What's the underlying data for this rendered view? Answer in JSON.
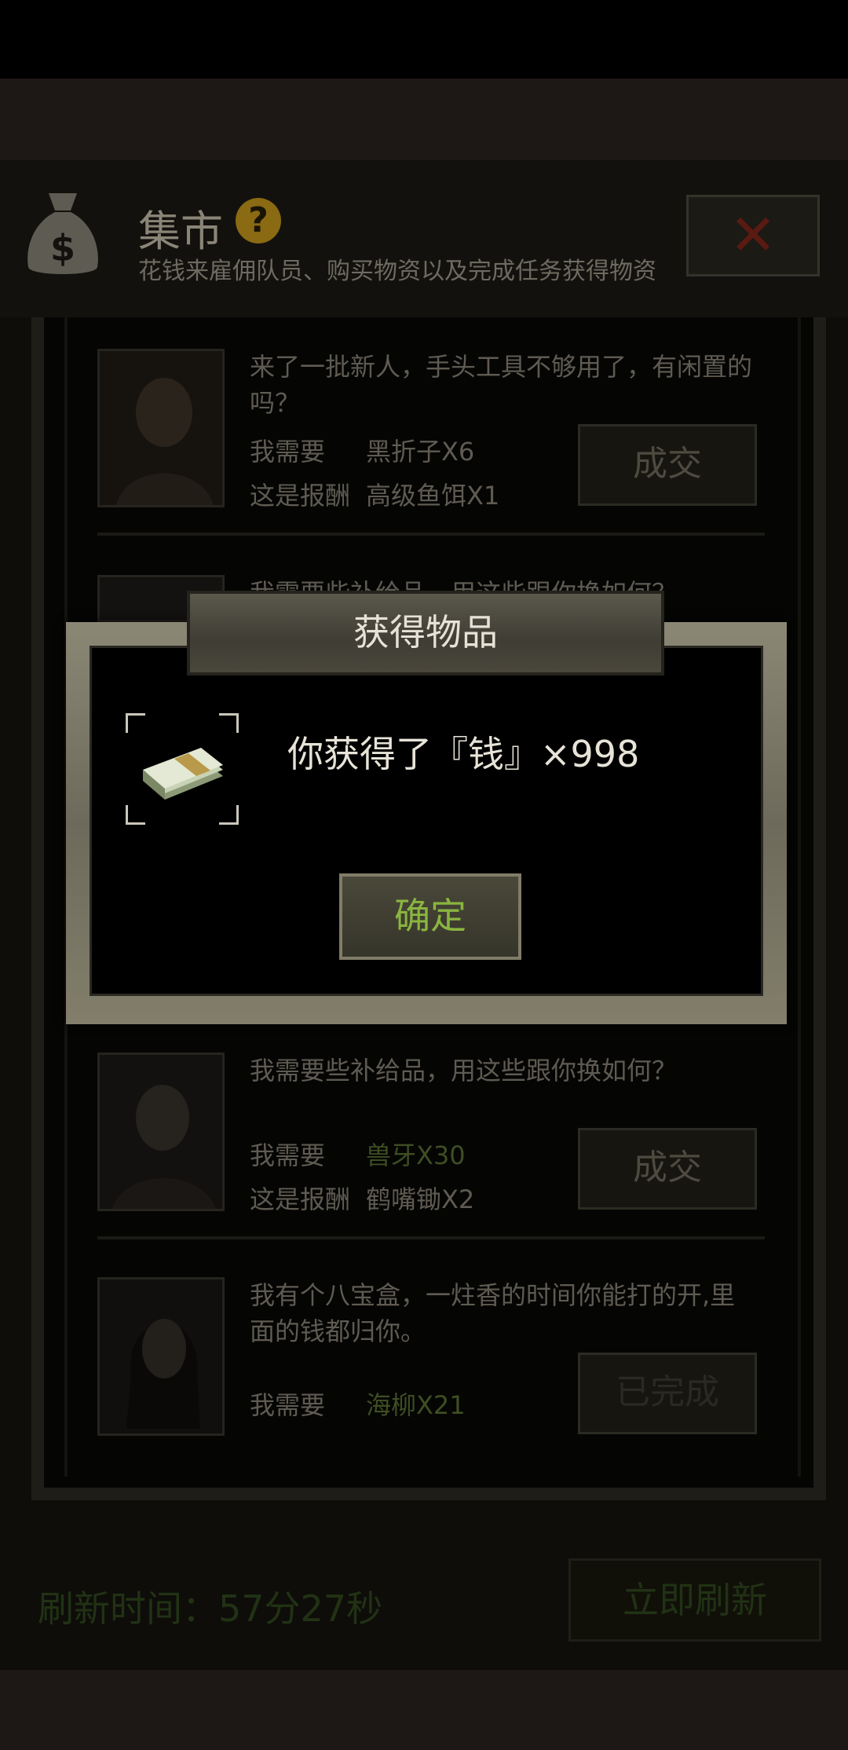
{
  "market": {
    "title": "集市",
    "help_icon": "?",
    "subtitle": "花钱来雇佣队员、购买物资以及完成任务获得物资",
    "close_icon": "✕"
  },
  "labels": {
    "need": "我需要",
    "reward": "这是报酬"
  },
  "quests": [
    {
      "text": "来了一批新人，手头工具不够用了，有闲置的吗？",
      "need_value": "黑折子X6",
      "reward_value": "高级鱼饵X1",
      "button": "成交"
    },
    {
      "text": "我需要些补给品，用这些跟你换如何？",
      "need_value": "",
      "reward_value": "",
      "button": ""
    },
    {
      "text": "我需要些补给品，用这些跟你换如何？",
      "need_value": "兽牙X30",
      "reward_value": "鹤嘴锄X2",
      "button": "成交"
    },
    {
      "text": "我有个八宝盒，一炷香的时间你能打的开,里面的钱都归你。",
      "need_value": "海柳X21",
      "button": "已完成"
    }
  ],
  "refresh": {
    "label": "刷新时间：57分27秒",
    "button": "立即刷新"
  },
  "dialog": {
    "title": "获得物品",
    "message": "你获得了『钱』×998",
    "item_icon": "money-stack-icon",
    "confirm": "确定"
  },
  "colors": {
    "confirm_text": "#8ab540",
    "help_icon": "#8a6a12"
  }
}
